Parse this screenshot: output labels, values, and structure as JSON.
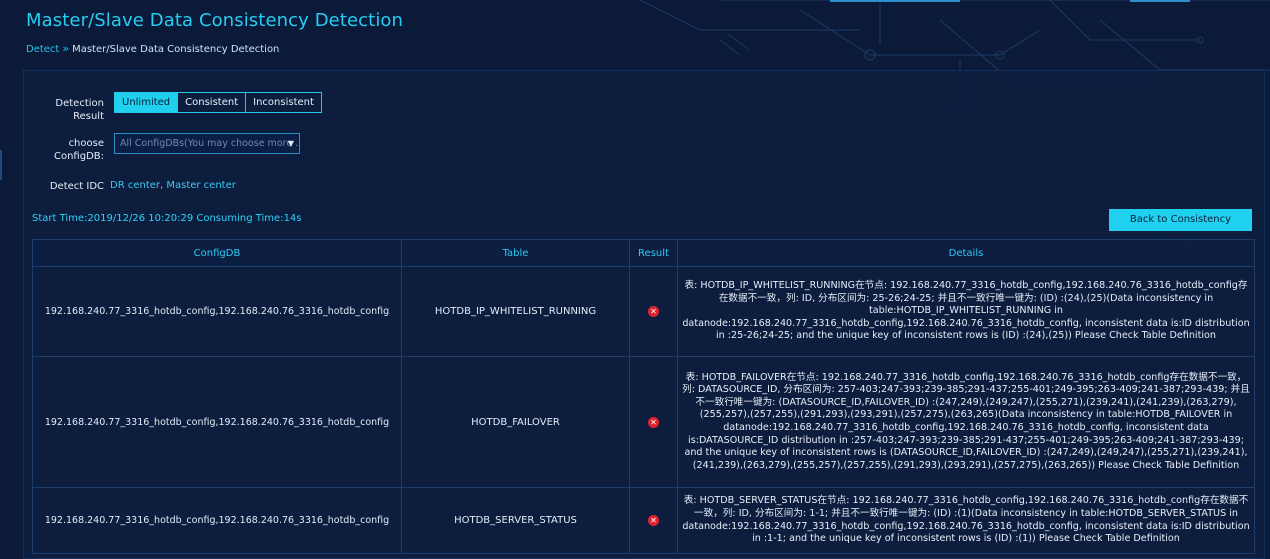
{
  "page": {
    "title": "Master/Slave Data Consistency Detection"
  },
  "breadcrumb": {
    "link": "Detect",
    "separator": "»",
    "current": "Master/Slave Data Consistency Detection"
  },
  "filters": {
    "detection_result_label": "Detection Result",
    "detection_result_options": [
      "Unlimited",
      "Consistent",
      "Inconsistent"
    ],
    "detection_result_selected": "Unlimited",
    "configdb_label": "choose ConfigDB:",
    "configdb_placeholder": "All ConfigDBs(You may choose more ...",
    "detect_idc_label": "Detect IDC",
    "detect_idc_value": "DR center, Master center"
  },
  "summary": {
    "text": "Start Time:2019/12/26 10:20:29 Consuming Time:14s"
  },
  "actions": {
    "back_label": "Back to Consistency Detection"
  },
  "table": {
    "headers": [
      "ConfigDB",
      "Table",
      "Result",
      "Details"
    ],
    "rows": [
      {
        "configdb": "192.168.240.77_3316_hotdb_config,192.168.240.76_3316_hotdb_config",
        "table": "HOTDB_IP_WHITELIST_RUNNING",
        "result_icon": "error-icon",
        "details": "表: HOTDB_IP_WHITELIST_RUNNING在节点: 192.168.240.77_3316_hotdb_config,192.168.240.76_3316_hotdb_config存在数据不一致，列: ID, 分布区间为: 25-26;24-25; 并且不一致行唯一键为: (ID) :(24),(25)(Data inconsistency in table:HOTDB_IP_WHITELIST_RUNNING in datanode:192.168.240.77_3316_hotdb_config,192.168.240.76_3316_hotdb_config, inconsistent data is:ID distribution in :25-26;24-25; and the unique key of inconsistent rows is (ID) :(24),(25)) Please Check Table Definition"
      },
      {
        "configdb": "192.168.240.77_3316_hotdb_config,192.168.240.76_3316_hotdb_config",
        "table": "HOTDB_FAILOVER",
        "result_icon": "error-icon",
        "details": "表: HOTDB_FAILOVER在节点: 192.168.240.77_3316_hotdb_config,192.168.240.76_3316_hotdb_config存在数据不一致，列: DATASOURCE_ID, 分布区间为: 257-403;247-393;239-385;291-437;255-401;249-395;263-409;241-387;293-439; 并且不一致行唯一键为: (DATASOURCE_ID,FAILOVER_ID) :(247,249),(249,247),(255,271),(239,241),(241,239),(263,279),(255,257),(257,255),(291,293),(293,291),(257,275),(263,265)(Data inconsistency in table:HOTDB_FAILOVER in datanode:192.168.240.77_3316_hotdb_config,192.168.240.76_3316_hotdb_config, inconsistent data is:DATASOURCE_ID distribution in :257-403;247-393;239-385;291-437;255-401;249-395;263-409;241-387;293-439; and the unique key of inconsistent rows is (DATASOURCE_ID,FAILOVER_ID) :(247,249),(249,247),(255,271),(239,241),(241,239),(263,279),(255,257),(257,255),(291,293),(293,291),(257,275),(263,265)) Please Check Table Definition"
      },
      {
        "configdb": "192.168.240.77_3316_hotdb_config,192.168.240.76_3316_hotdb_config",
        "table": "HOTDB_SERVER_STATUS",
        "result_icon": "error-icon",
        "details": "表: HOTDB_SERVER_STATUS在节点: 192.168.240.77_3316_hotdb_config,192.168.240.76_3316_hotdb_config存在数据不一致，列: ID, 分布区间为: 1-1; 并且不一致行唯一键为: (ID) :(1)(Data inconsistency in table:HOTDB_SERVER_STATUS in datanode:192.168.240.77_3316_hotdb_config,192.168.240.76_3316_hotdb_config, inconsistent data is:ID distribution in :1-1; and the unique key of inconsistent rows is (ID) :(1)) Please Check Table Definition"
      }
    ]
  },
  "colors": {
    "background": "#0b1a38",
    "accent": "#1fd0ef",
    "title": "#27cdf2",
    "error": "#e0232d"
  }
}
